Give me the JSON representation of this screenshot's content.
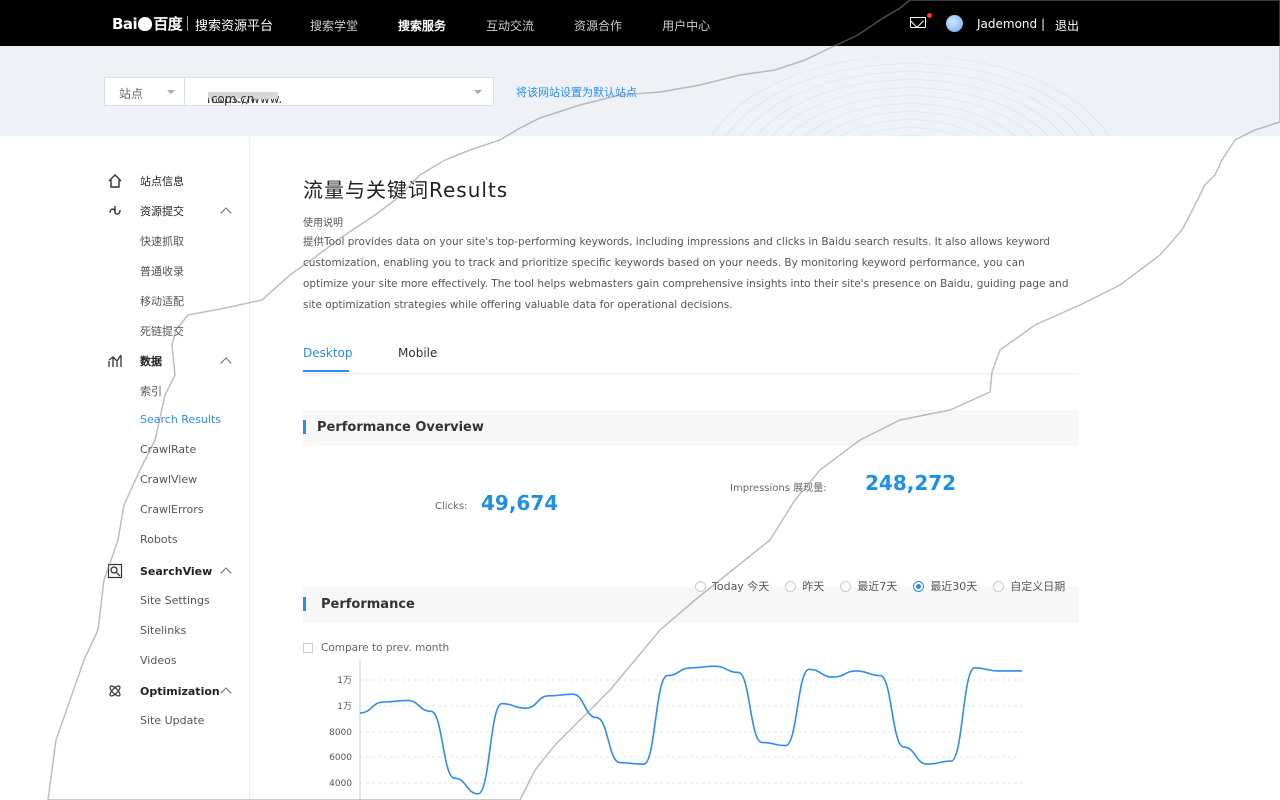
{
  "header": {
    "logo_text": "Bai",
    "logo_suffix": "百度",
    "platform": "搜索资源平台",
    "nav": [
      "搜索学堂",
      "搜索服务",
      "互动交流",
      "资源合作",
      "用户中心"
    ],
    "active_nav": 1,
    "username": "Jademond",
    "separator": "|",
    "logout": "退出"
  },
  "site_bar": {
    "select_label": "站点",
    "url_prefix": "https://www.",
    "url_suffix": ".com.cn",
    "set_default": "将该网站设置为默认站点"
  },
  "sidebar": {
    "groups": [
      {
        "label": "站点信息",
        "icon": "home-icon"
      },
      {
        "label": "资源提交",
        "icon": "submit-icon"
      },
      {
        "label": "数据",
        "icon": "data-icon"
      },
      {
        "label": "SearchView",
        "icon": "search-view-icon"
      },
      {
        "label": "Optimization",
        "icon": "optimization-icon"
      }
    ],
    "submit_items": [
      "快速抓取",
      "普通收录",
      "移动适配",
      "死链提交"
    ],
    "data_items": [
      "索引",
      "Search Results",
      "CrawlRate",
      "CrawlView",
      "CrawlErrors",
      "Robots"
    ],
    "searchview_items": [
      "Site Settings",
      "Sitelinks",
      "Videos"
    ],
    "optimization_items": [
      "Site Update"
    ]
  },
  "main": {
    "title": "流量与关键词Results",
    "usage_label": "使用说明",
    "description": "提供Tool provides data on your site's top-performing keywords, including impressions and clicks in Baidu search results. It also allows keyword customization, enabling you to track and prioritize specific keywords based on your needs. By monitoring keyword performance, you can optimize your site more effectively. The tool helps webmasters gain comprehensive insights into their site's presence on Baidu, guiding page and site optimization strategies while offering valuable data for operational decisions.",
    "tabs": [
      "Desktop",
      "Mobile"
    ],
    "overview_title": "Performance Overview",
    "clicks_label": "Clicks:",
    "clicks_value": "49,674",
    "impressions_label": "Impressions 展现量:",
    "impressions_value": "248,272",
    "performance_title": "Performance",
    "date_ranges": [
      "Today 今天",
      "昨天",
      "最近7天",
      "最近30天",
      "自定义日期"
    ],
    "selected_range": 3,
    "compare_label": "Compare to prev. month"
  },
  "colors": {
    "accent": "#2d8cf0",
    "metric": "#1e90e6",
    "topbar": "#000000"
  },
  "chart_data": {
    "type": "line",
    "y_ticks": [
      "1万",
      "1万",
      "8000",
      "6000",
      "4000"
    ],
    "ylim": [
      3000,
      12000
    ],
    "series": [
      {
        "values": [
          8600,
          9300,
          9400,
          8700,
          4400,
          3400,
          9200,
          8900,
          9700,
          9800,
          8300,
          5400,
          5300,
          11000,
          11500,
          11600,
          11200,
          6700,
          6500,
          11400,
          10900,
          11300,
          11000,
          6400,
          5300,
          5500,
          11500,
          11300,
          11300
        ]
      }
    ]
  }
}
